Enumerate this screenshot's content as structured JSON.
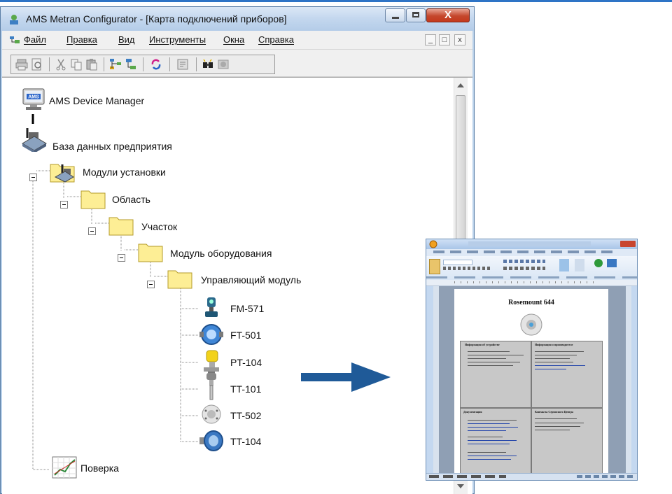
{
  "window": {
    "title": "AMS Metran Configurator - [Карта подключений приборов]",
    "close_glyph": "X",
    "mdi_buttons": [
      "_",
      "□",
      "x"
    ]
  },
  "menu": {
    "items": [
      "Файл",
      "Правка",
      "Вид",
      "Инструменты",
      "Окна",
      "Справка"
    ]
  },
  "tree": {
    "root": "AMS Device Manager",
    "database": "База данных предприятия",
    "plant_modules": "Модули установки",
    "area": "Область",
    "unit": "Участок",
    "equipment_module": "Модуль оборудования",
    "control_module": "Управляющий модуль",
    "devices": [
      "FM-571",
      "FT-501",
      "PT-104",
      "TT-101",
      "TT-502",
      "TT-104"
    ],
    "calibration": "Поверка"
  },
  "doc": {
    "heading": "Rosemount 644",
    "cell_headers": [
      "Информация об устройстве",
      "Информация о производителе",
      "Документация",
      "Контакты Сервисного Центра"
    ]
  },
  "colors": {
    "arrow": "#1f5a98",
    "folder": "#fdee95",
    "titlebar": "#c3d7ee",
    "close": "#c5391c"
  },
  "icons": {
    "toolbar": [
      "print-icon",
      "print-preview-icon",
      "cut-icon",
      "copy-icon",
      "paste-icon",
      "network-icon",
      "device-tree-icon",
      "refresh-icon",
      "properties-icon",
      "find-icon",
      "disabled-icon"
    ]
  }
}
